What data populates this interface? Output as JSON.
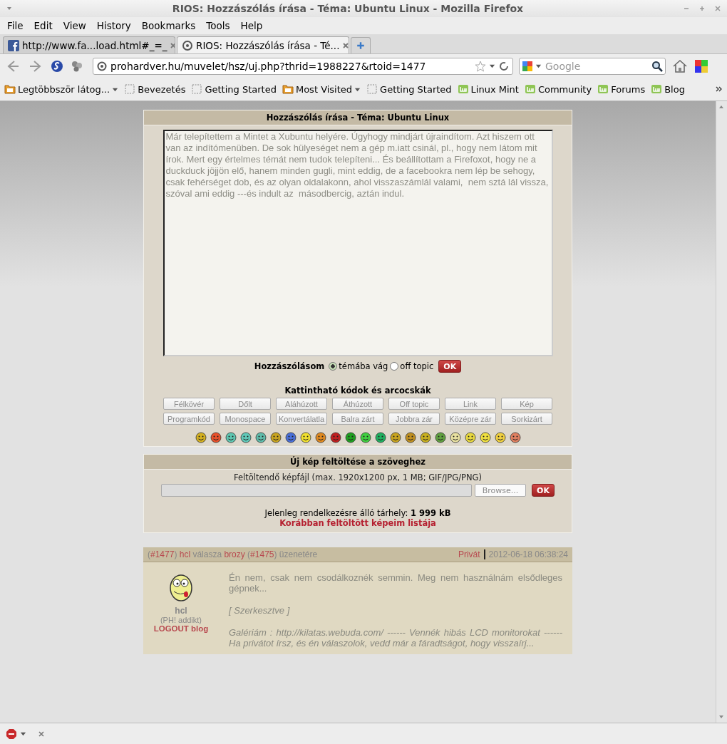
{
  "window": {
    "title": "RIOS: Hozzászólás írása - Téma: Ubuntu Linux - Mozilla Firefox"
  },
  "menu": [
    "File",
    "Edit",
    "View",
    "History",
    "Bookmarks",
    "Tools",
    "Help"
  ],
  "tabs": [
    {
      "label": "http://www.fa...load.html#_=_",
      "kind": "facebook",
      "selected": false
    },
    {
      "label": "RIOS: Hozzászólás írása - Té...",
      "kind": "site",
      "selected": true
    }
  ],
  "navigation": {
    "url": "prohardver.hu/muvelet/hsz/uj.php?thrid=1988227&rtoid=1477",
    "search": {
      "placeholder": "Google"
    }
  },
  "bookmarks": [
    {
      "label": "Legtöbbször látog...",
      "kind": "folder",
      "dropdown": true
    },
    {
      "label": "Bevezetés",
      "kind": "page",
      "dropdown": false
    },
    {
      "label": "Getting Started",
      "kind": "page",
      "dropdown": false
    },
    {
      "label": "Most Visited",
      "kind": "folder",
      "dropdown": true
    },
    {
      "label": "Getting Started",
      "kind": "page",
      "dropdown": false
    },
    {
      "label": "Linux Mint",
      "kind": "mint",
      "dropdown": false
    },
    {
      "label": "Community",
      "kind": "mint",
      "dropdown": false
    },
    {
      "label": "Forums",
      "kind": "mint",
      "dropdown": false
    },
    {
      "label": "Blog",
      "kind": "mint",
      "dropdown": false
    }
  ],
  "compose": {
    "title": "Hozzászólás írása - Téma: Ubuntu Linux",
    "text": "Már telepítettem a Mintet a Xubuntu helyére. Úgyhogy mindjárt újraindítom. Azt hiszem ott van az indítómenüben. De sok hülyeséget nem a gép m.iatt csinál, pl., hogy nem látom mit írok. Mert egy értelmes témát nem tudok telepíteni... És beállítottam a Firefoxot, hogy ne a duckduck jöjjön elő, hanem minden gugli, mint eddig, de a facebookra nem lép be sehogy, csak fehérséget dob, és az olyan oldalakonn, ahol visszaszámlál valami,  nem sztá lál vissza, szóval ami eddig ---és indult az  másodbercig, aztán indul.",
    "post_type": {
      "label": "Hozzászólásom",
      "options": [
        {
          "label": "témába vág",
          "selected": true
        },
        {
          "label": "off topic",
          "selected": false
        }
      ],
      "ok": "OK"
    },
    "codes_title": "Kattintható kódok és arcocskák",
    "code_rows": [
      [
        "Félkövér",
        "Dőlt",
        "Aláhúzott",
        "Áthúzott",
        "Off topic",
        "Link",
        "Kép"
      ],
      [
        "Programkód",
        "Monospace",
        "Konvertálatla",
        "Balra zárt",
        "Jobbra zár",
        "Középre zár",
        "Sorkizárt"
      ]
    ]
  },
  "upload": {
    "title": "Új kép feltöltése a szöveghez",
    "hint": "Feltöltendő képfájl (max. 1920x1200 px, 1 MB; GIF/JPG/PNG)",
    "browse": "Browse...",
    "ok": "OK",
    "quota_label": "Jelenleg rendelkezésre álló tárhely:",
    "quota_value": "1 999 kB",
    "list_link": "Korábban feltöltött képeim listája"
  },
  "post": {
    "header": [
      {
        "text": "(",
        "kind": "plain"
      },
      {
        "text": "#1477",
        "kind": "link"
      },
      {
        "text": ") ",
        "kind": "plain"
      },
      {
        "text": "hcl",
        "kind": "link"
      },
      {
        "text": " válasza ",
        "kind": "plain"
      },
      {
        "text": "brozy",
        "kind": "link"
      },
      {
        "text": " (",
        "kind": "plain"
      },
      {
        "text": "#1475",
        "kind": "link"
      },
      {
        "text": ") üzenetére",
        "kind": "plain"
      }
    ],
    "private": "Privát",
    "date": "2012-06-18 06:38:24",
    "author": {
      "name": "hcl",
      "rank": "(PH! addikt)",
      "blog": "LOGOUT blog"
    },
    "body": "Én nem, csak nem csodálkoznék semmin. Meg nem használnám elsődleges gépnek...",
    "edited": "[ Szerkesztve ]",
    "signature": "Galériám : http://kilatas.webuda.com/ ------ Vennék hibás LCD monitorokat ------ Ha privátot írsz, és én válaszolok, vedd már a fáradtságot, hogy visszaírj..."
  }
}
